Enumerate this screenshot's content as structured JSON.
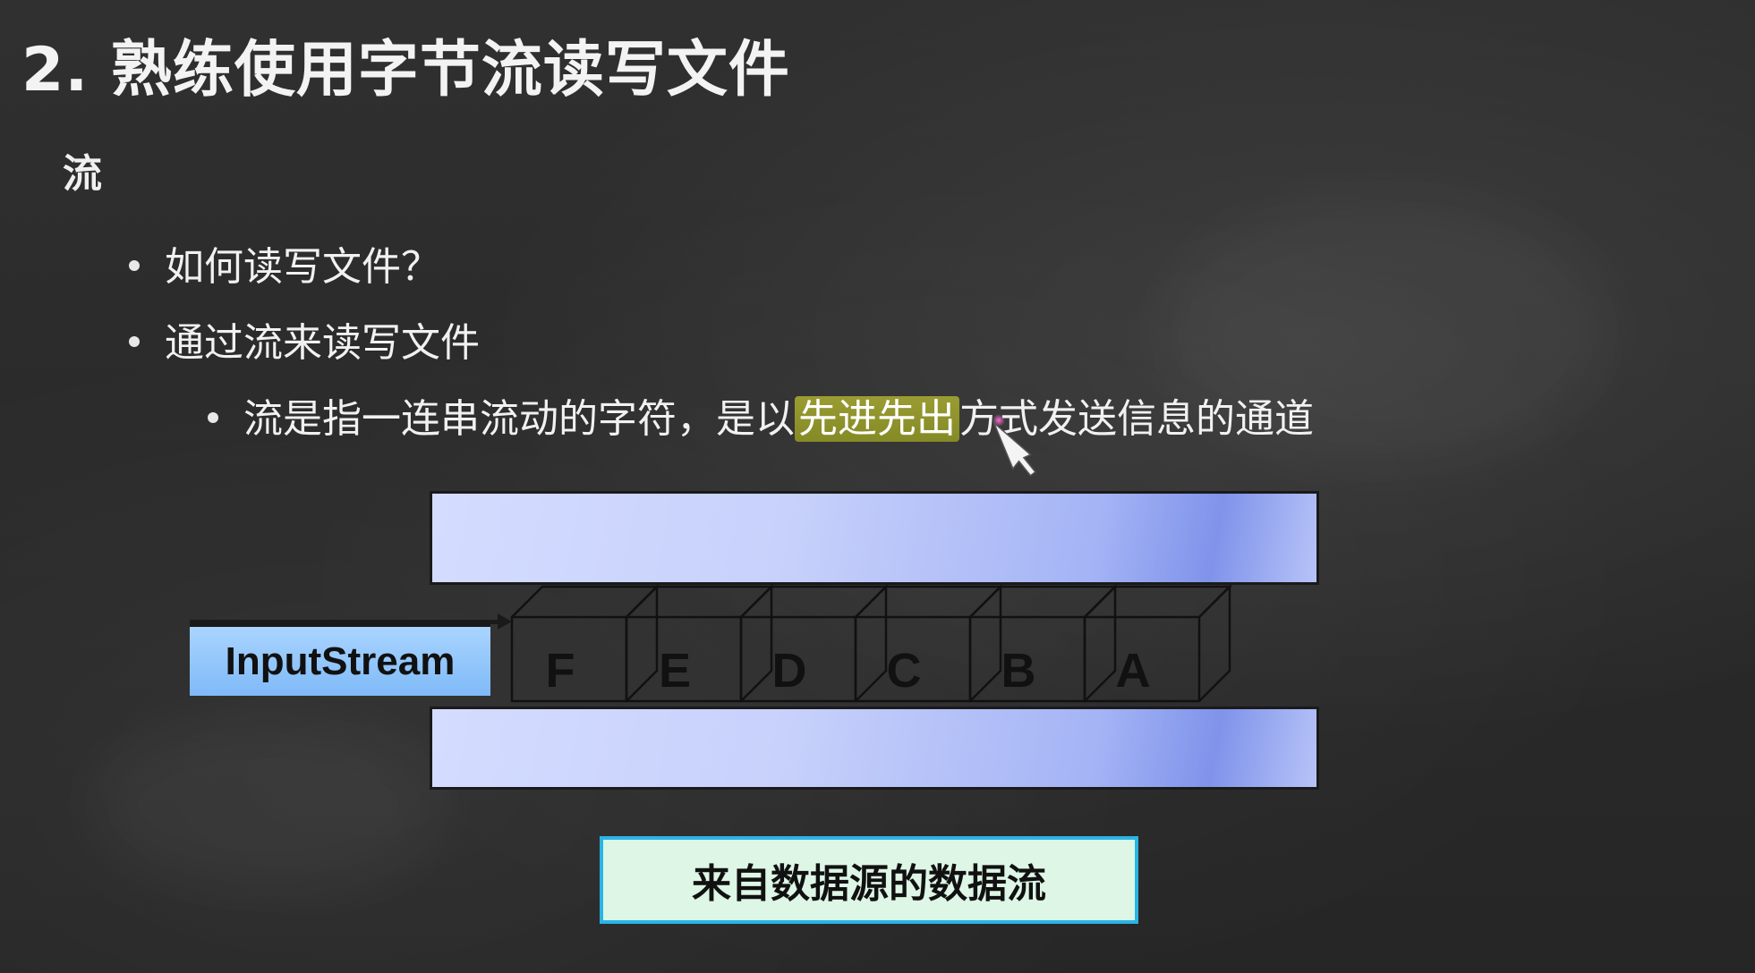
{
  "slide": {
    "title": "2. 熟练使用字节流读写文件",
    "section": "流",
    "bullets": [
      "如何读写文件？",
      "通过流来读写文件"
    ],
    "sub_bullet": {
      "before": "流是指一连串流动的字符，是以",
      "highlight": "先进先出",
      "after": "方式发送信息的通道"
    }
  },
  "diagram": {
    "input_label": "InputStream",
    "cube_letters": [
      "F",
      "E",
      "D",
      "C",
      "B",
      "A"
    ],
    "source_label": "来自数据源的数据流"
  },
  "colors": {
    "background": "#2c2c2c",
    "highlight": "#8a8a2a",
    "pipe": "#c7d1fb",
    "input_box": "#8fc4fb",
    "source_box_fill": "#ddf6e5",
    "source_box_border": "#2ab4e6"
  },
  "icons": {
    "cursor": "laser-pointer-cursor-icon"
  }
}
